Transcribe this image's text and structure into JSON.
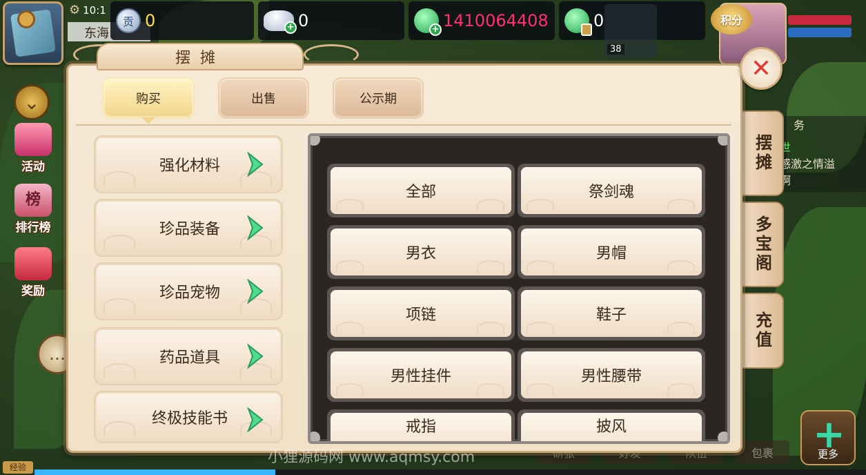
{
  "hud": {
    "time": "10:1",
    "location": "东海",
    "contribution_icon": "贡",
    "contribution": "0",
    "silver": "0",
    "jade": "1410064408",
    "bound_jade": "0",
    "points_label": "积分",
    "pet_level": "38"
  },
  "side_menu": {
    "activity": "活动",
    "ranking_icon": "榜",
    "ranking": "排行榜",
    "reward": "奖励"
  },
  "right_tabs": [
    "摆摊",
    "多宝阁",
    "充值"
  ],
  "quest": {
    "title": "务",
    "line1": "世",
    "line2": "感激之情溢",
    "line3": "啊"
  },
  "bottom": {
    "btn1": "研张",
    "btn2": "好发",
    "btn3": "队伍",
    "btn4": "包裹",
    "more": "更多",
    "exp_label": "经验",
    "exp_progress": 0.29,
    "watermark": "小狸源码网 www.aqmsy.com"
  },
  "panel": {
    "title": "摆摊",
    "close_symbol": "✕",
    "tabs": [
      "购买",
      "出售",
      "公示期"
    ],
    "active_tab": "购买",
    "categories": [
      "强化材料",
      "珍品装备",
      "珍品宠物",
      "药品道具",
      "终极技能书"
    ],
    "subcategories": [
      "全部",
      "祭剑魂",
      "男衣",
      "男帽",
      "项链",
      "鞋子",
      "男性挂件",
      "男性腰带",
      "戒指",
      "披风"
    ]
  },
  "colors": {
    "jade_value": "#ff2f74",
    "contribution_value": "#ffdf4a",
    "chevron": "#4fdc8c",
    "close_x": "#e03a33"
  },
  "icons": [
    "gear-icon",
    "compass-map-icon",
    "contribution-coin-icon",
    "silver-ingot-icon",
    "jade-icon",
    "bound-jade-icon",
    "chevron-right-icon",
    "close-icon",
    "chat-icon",
    "collapse-chevron-icon",
    "plus-icon"
  ]
}
